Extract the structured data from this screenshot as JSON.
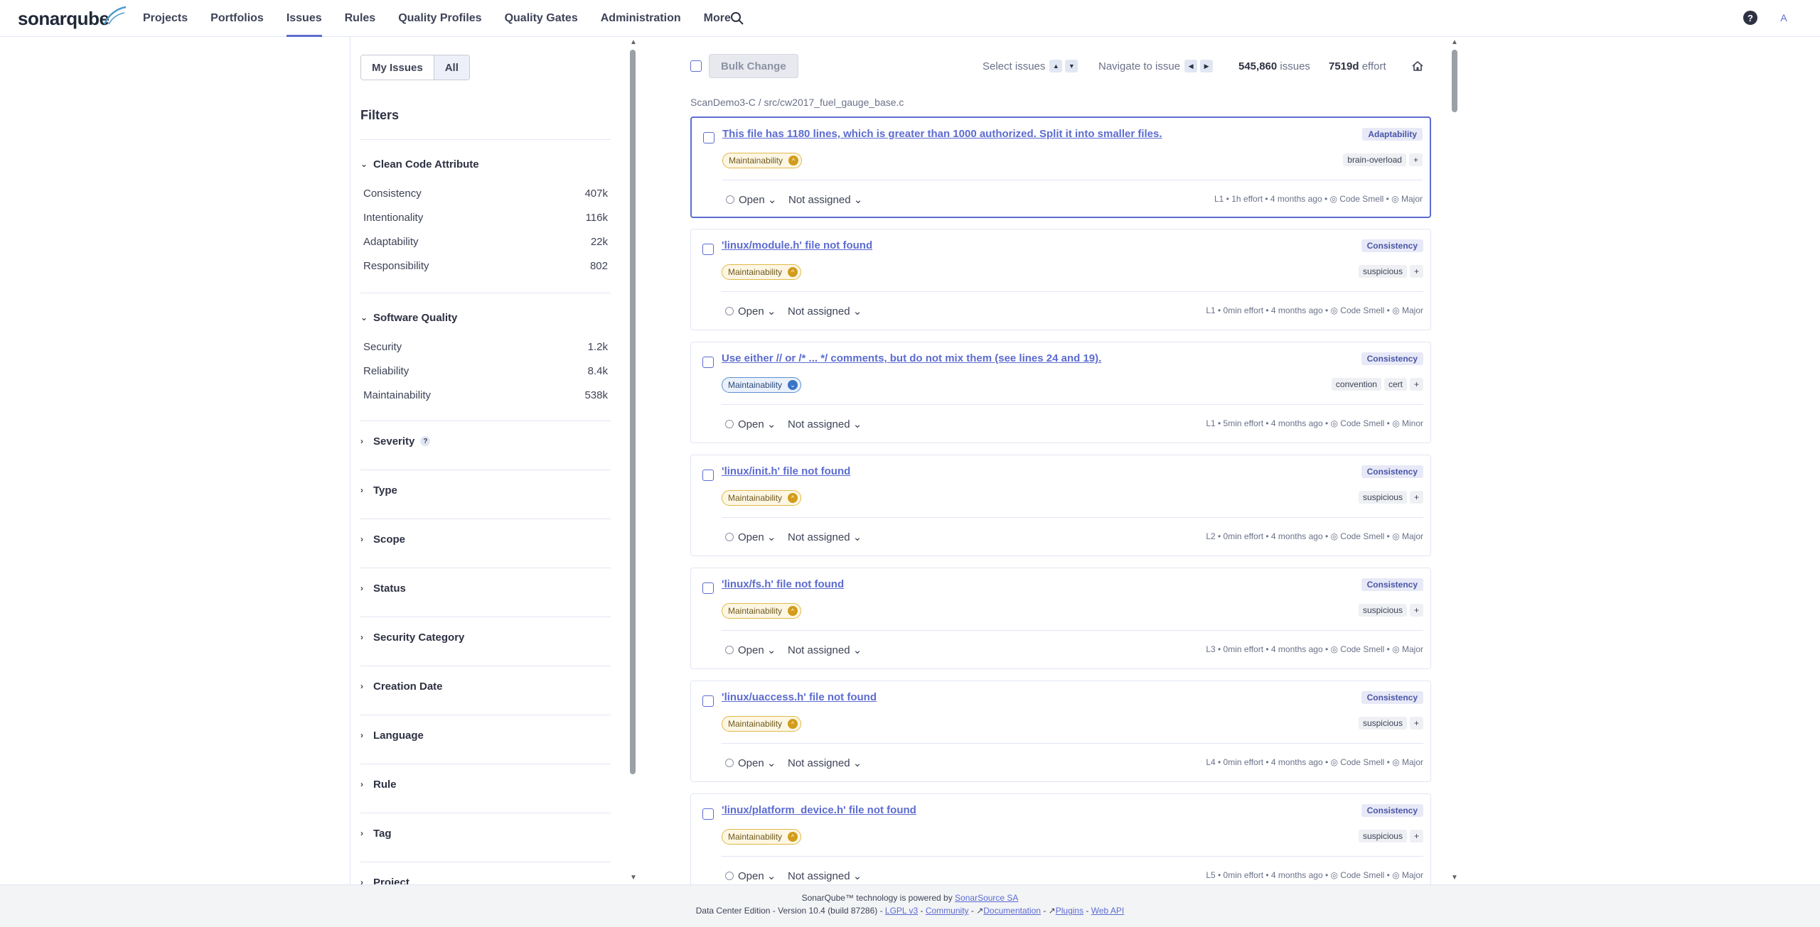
{
  "app": {
    "logo": "sonarqube",
    "nav": [
      "Projects",
      "Portfolios",
      "Issues",
      "Rules",
      "Quality Profiles",
      "Quality Gates",
      "Administration",
      "More"
    ],
    "active_nav": "Issues",
    "avatar_letter": "A",
    "help_label": "?"
  },
  "sidebar": {
    "toggle": [
      "My Issues",
      "All"
    ],
    "filters_title": "Filters",
    "clean_code": {
      "title": "Clean Code Attribute",
      "items": [
        {
          "label": "Consistency",
          "count": "407k"
        },
        {
          "label": "Intentionality",
          "count": "116k"
        },
        {
          "label": "Adaptability",
          "count": "22k"
        },
        {
          "label": "Responsibility",
          "count": "802"
        }
      ]
    },
    "software_quality": {
      "title": "Software Quality",
      "items": [
        {
          "label": "Security",
          "count": "1.2k"
        },
        {
          "label": "Reliability",
          "count": "8.4k"
        },
        {
          "label": "Maintainability",
          "count": "538k"
        }
      ]
    },
    "collapsed": [
      "Severity",
      "Type",
      "Scope",
      "Status",
      "Security Category",
      "Creation Date",
      "Language",
      "Rule",
      "Tag",
      "Project"
    ],
    "severity_help": "?"
  },
  "toolbar": {
    "bulk_change": "Bulk Change",
    "select_issues": "Select issues",
    "navigate": "Navigate to issue",
    "issues_count": "545,860",
    "issues_label": "issues",
    "effort": "7519d",
    "effort_label": "effort"
  },
  "breadcrumb": {
    "project": "ScanDemo3-C",
    "sep": "/",
    "file": "src/cw2017_fuel_gauge_base.c"
  },
  "issues": [
    {
      "title": "This file has 1180 lines, which is greater than 1000 authorized. Split it into smaller files.",
      "attribute": "Adaptability",
      "quality": "Maintainability",
      "quality_level": "medium",
      "tags": [
        "brain-overload",
        "+"
      ],
      "status": "Open",
      "assignee": "Not assigned",
      "meta": "L1 • 1h effort • 4 months ago • ◎ Code Smell • ◎ Major"
    },
    {
      "title": "'linux/module.h' file not found",
      "attribute": "Consistency",
      "quality": "Maintainability",
      "quality_level": "medium",
      "tags": [
        "suspicious",
        "+"
      ],
      "status": "Open",
      "assignee": "Not assigned",
      "meta": "L1 • 0min effort • 4 months ago • ◎ Code Smell • ◎ Major"
    },
    {
      "title": "Use either // or /* ... */ comments, but do not mix them (see lines 24 and 19).",
      "attribute": "Consistency",
      "quality": "Maintainability",
      "quality_level": "low",
      "tags": [
        "convention",
        "cert",
        "+"
      ],
      "status": "Open",
      "assignee": "Not assigned",
      "meta": "L1 • 5min effort • 4 months ago • ◎ Code Smell • ◎ Minor"
    },
    {
      "title": "'linux/init.h' file not found",
      "attribute": "Consistency",
      "quality": "Maintainability",
      "quality_level": "medium",
      "tags": [
        "suspicious",
        "+"
      ],
      "status": "Open",
      "assignee": "Not assigned",
      "meta": "L2 • 0min effort • 4 months ago • ◎ Code Smell • ◎ Major"
    },
    {
      "title": "'linux/fs.h' file not found",
      "attribute": "Consistency",
      "quality": "Maintainability",
      "quality_level": "medium",
      "tags": [
        "suspicious",
        "+"
      ],
      "status": "Open",
      "assignee": "Not assigned",
      "meta": "L3 • 0min effort • 4 months ago • ◎ Code Smell • ◎ Major"
    },
    {
      "title": "'linux/uaccess.h' file not found",
      "attribute": "Consistency",
      "quality": "Maintainability",
      "quality_level": "medium",
      "tags": [
        "suspicious",
        "+"
      ],
      "status": "Open",
      "assignee": "Not assigned",
      "meta": "L4 • 0min effort • 4 months ago • ◎ Code Smell • ◎ Major"
    },
    {
      "title": "'linux/platform_device.h' file not found",
      "attribute": "Consistency",
      "quality": "Maintainability",
      "quality_level": "medium",
      "tags": [
        "suspicious",
        "+"
      ],
      "status": "Open",
      "assignee": "Not assigned",
      "meta": "L5 • 0min effort • 4 months ago • ◎ Code Smell • ◎ Major"
    }
  ],
  "footer": {
    "line1_prefix": "SonarQube™ technology is powered by",
    "line1_link": "SonarSource SA",
    "edition": "Data Center Edition - Version 10.4 (build 87286) -",
    "links": [
      "LGPL v3",
      "Community",
      "Documentation",
      "Plugins",
      "Web API"
    ]
  },
  "colors": {
    "accent": "#5d6cd0",
    "medium_severity": "#d29c1b",
    "low_severity": "#3a74c7"
  }
}
